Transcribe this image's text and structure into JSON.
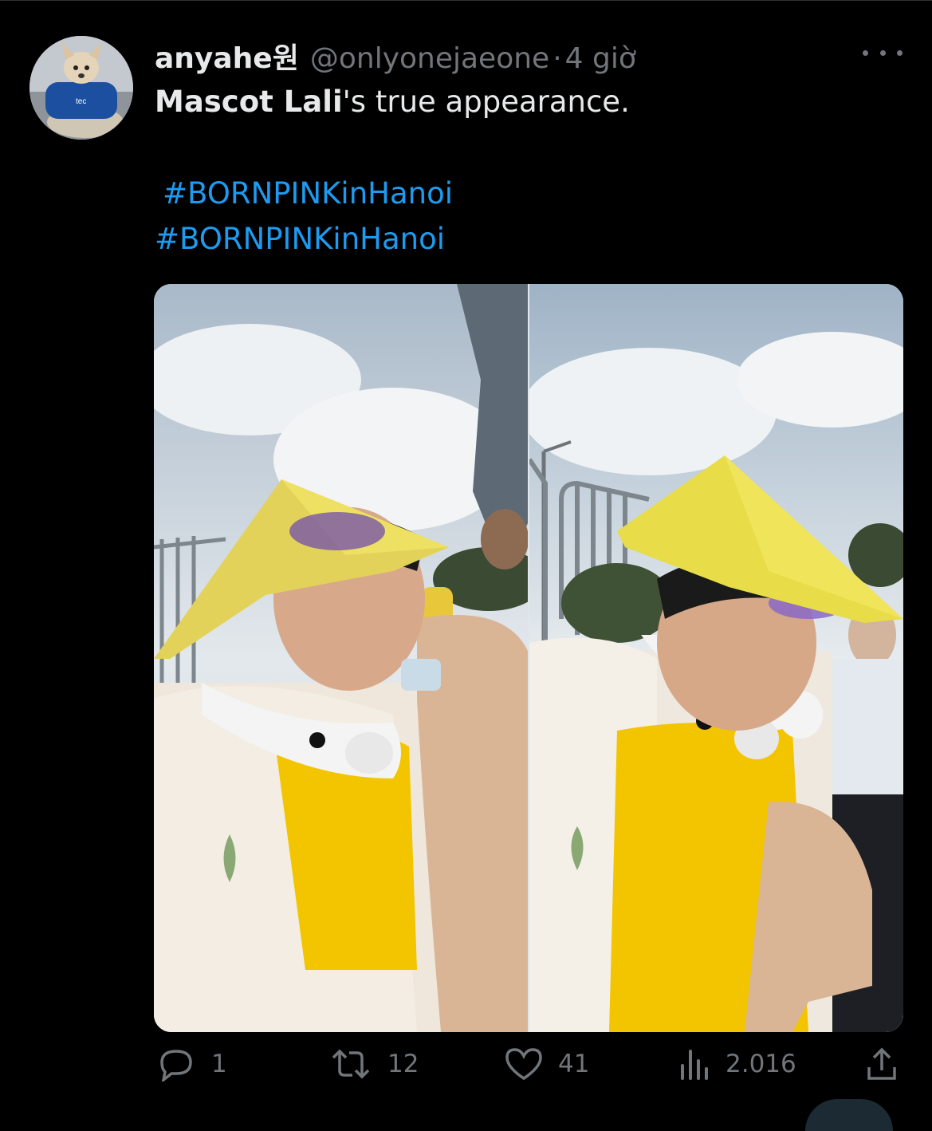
{
  "tweet": {
    "display_name": "anyahe원",
    "handle": "@onlyonejaeone",
    "separator": "·",
    "time": "4 giờ",
    "text_bold": "Mascot Lali",
    "text_rest": "'s true appearance.",
    "hashtags": [
      "#BORNPINKinHanoi",
      "#BORNPINKinHanoi"
    ]
  },
  "actions": {
    "reply_count": "1",
    "retweet_count": "12",
    "like_count": "41",
    "views_count": "2.016"
  },
  "icons": {
    "more": "more-icon",
    "reply": "reply-icon",
    "retweet": "retweet-icon",
    "like": "heart-icon",
    "views": "views-icon",
    "share": "share-icon"
  },
  "colors": {
    "background": "#000000",
    "text": "#e7e9ea",
    "muted": "#71767b",
    "link": "#1d9bf0",
    "hat_yellow": "#e9d84a",
    "vest_yellow": "#f2c500"
  }
}
